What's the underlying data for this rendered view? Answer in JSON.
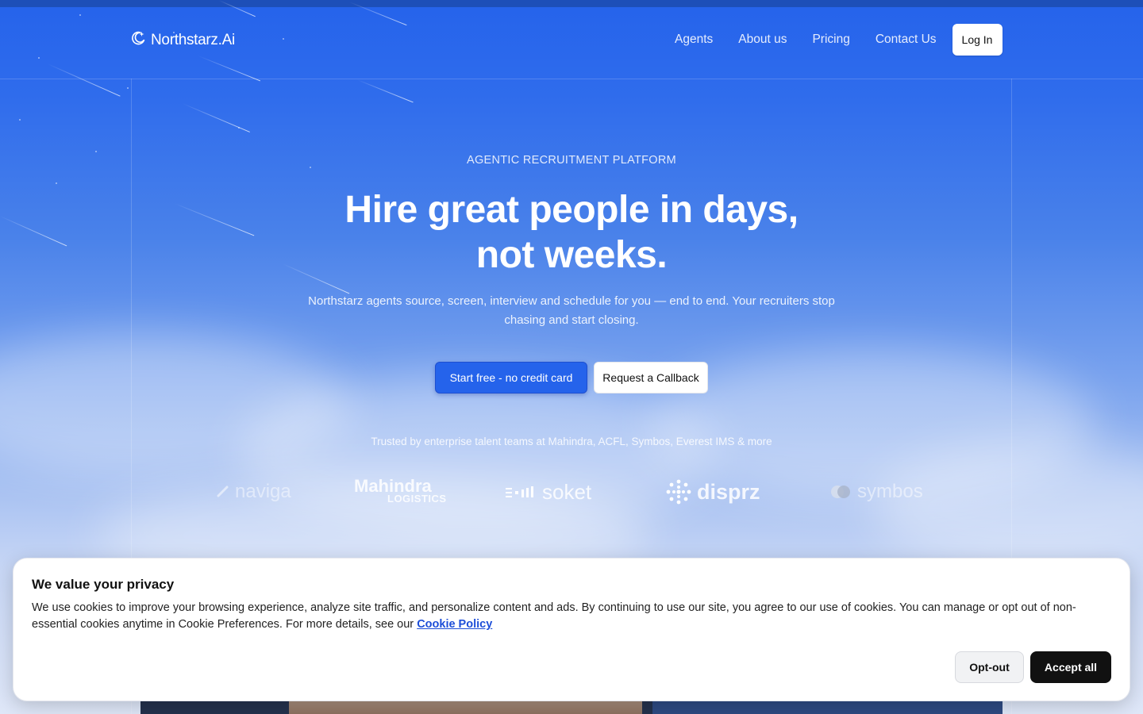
{
  "brand": {
    "name": "Northstarz.Ai",
    "logo_icon": "crescent-sparkle-icon"
  },
  "nav": {
    "items": [
      {
        "label": "Agents"
      },
      {
        "label": "About us"
      },
      {
        "label": "Pricing"
      },
      {
        "label": "Contact Us"
      }
    ],
    "login_label": "Log In"
  },
  "hero": {
    "eyebrow": "AGENTIC RECRUITMENT PLATFORM",
    "headline_line1": "Hire great people in days,",
    "headline_line2": "not weeks.",
    "subhead": "Northstarz agents source, screen, interview and schedule for you — end to end. Your recruiters stop chasing and start closing.",
    "primary_cta": "Start free - no credit card",
    "secondary_cta": "Request a Callback",
    "trusted": "Trusted by enterprise talent teams at Mahindra, ACFL, Symbos, Everest IMS & more"
  },
  "logos": {
    "naviga": "naviga",
    "mahindra_main": "Mahindra",
    "mahindra_sub": "LOGISTICS",
    "soket": "soket",
    "disprz": "disprz",
    "symbos": "symbos"
  },
  "cookie": {
    "title": "We value your privacy",
    "body": "We use cookies to improve your browsing experience, analyze site traffic, and personalize content and ads. By continuing to use our site, you agree to our use of cookies. You can manage or opt out of non-essential cookies anytime in Cookie Preferences. For more details, see our",
    "link_label": "Cookie Policy",
    "optout_label": "Opt-out",
    "accept_label": "Accept all"
  },
  "colors": {
    "primary": "#2563eb",
    "dark_button": "#111111",
    "link": "#1d4ed8"
  }
}
